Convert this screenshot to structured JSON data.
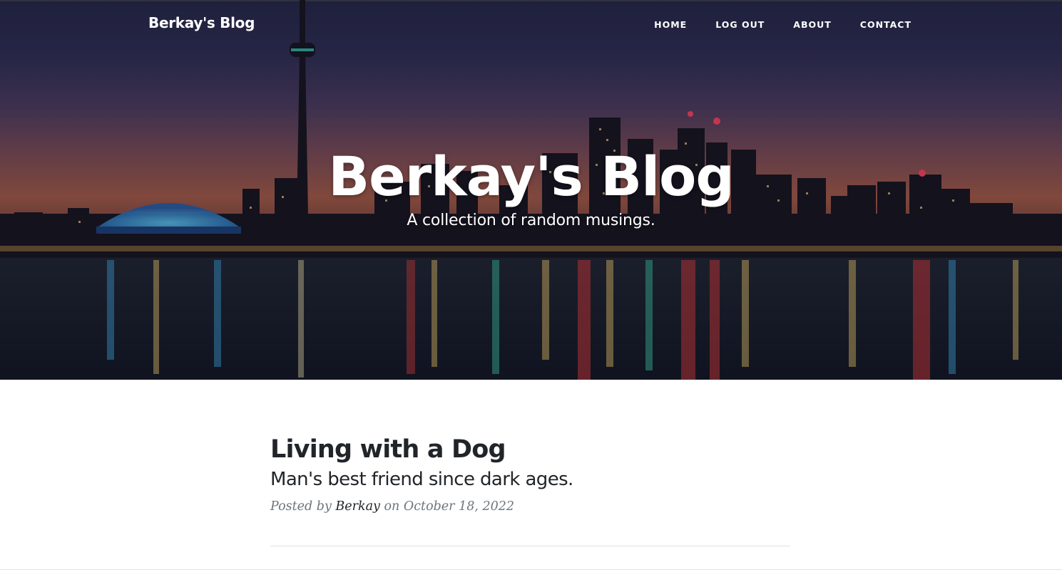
{
  "navbar": {
    "brand": "Berkay's Blog",
    "links": [
      {
        "label": "HOME"
      },
      {
        "label": "LOG OUT"
      },
      {
        "label": "ABOUT"
      },
      {
        "label": "CONTACT"
      }
    ]
  },
  "hero": {
    "title": "Berkay's Blog",
    "subtitle": "A collection of random musings."
  },
  "post": {
    "title": "Living with a Dog",
    "subtitle": "Man's best friend since dark ages.",
    "meta_prefix": "Posted by",
    "author": "Berkay",
    "meta_mid": "on",
    "date": "October 18, 2022"
  },
  "colors": {
    "heading_text": "#212529",
    "meta_text": "#6c757d",
    "divider": "#dee2e6"
  }
}
